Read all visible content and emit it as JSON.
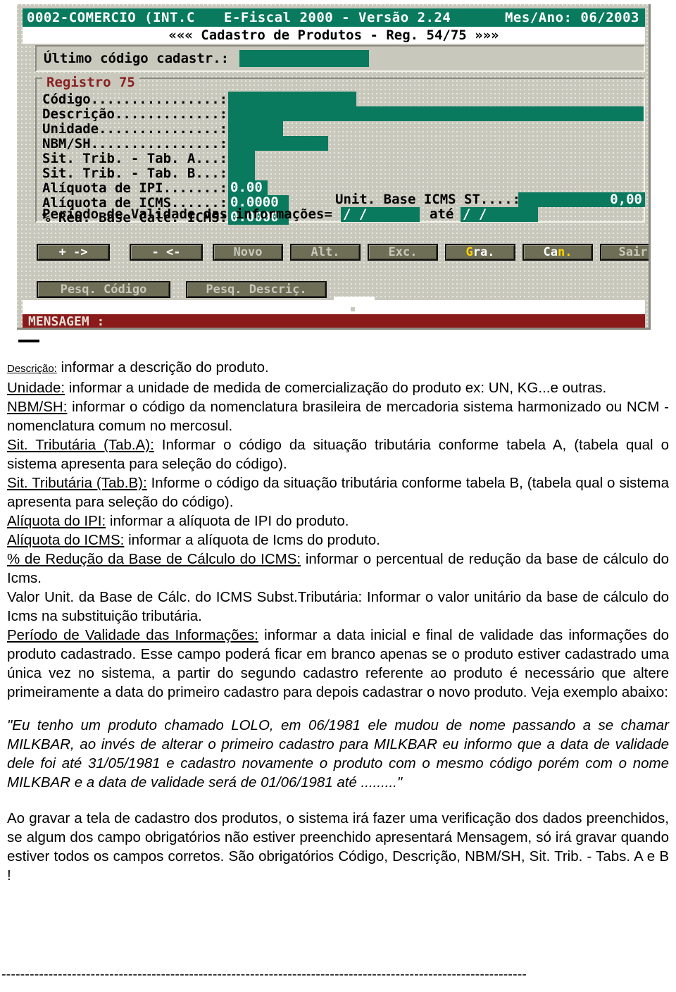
{
  "terminal": {
    "titlebar": {
      "company": "0002-COMERCIO (INT.C",
      "app": "E-Fiscal 2000 - Versão 2.24",
      "period": "Mes/Ano: 06/2003"
    },
    "subtitle": "««« Cadastro de Produtos - Reg. 54/75 »»»",
    "last_code_label": "Último código cadastr.:",
    "last_code_value": "",
    "group_legend": "Registro 75",
    "fields": [
      {
        "label": "Código................:",
        "value": ""
      },
      {
        "label": "Descrição.............:",
        "value": ""
      },
      {
        "label": "Unidade...............:",
        "value": ""
      },
      {
        "label": "NBM/SH................:",
        "value": ""
      },
      {
        "label": "Sit. Trib. - Tab. A...:",
        "value": ""
      },
      {
        "label": "Sit. Trib. - Tab. B...:",
        "value": ""
      },
      {
        "label": "Alíquota de IPI.......:",
        "value": "0.00"
      },
      {
        "label": "Alíquota de ICMS......:",
        "value": "0.0000"
      },
      {
        "label": "% Red. Base Calc. ICMS:",
        "value": "0.0000"
      }
    ],
    "unit_base_icms_st_label": "Unit. Base ICMS ST....:",
    "unit_base_icms_st_value": "0,00",
    "validity_label": "Período de Validade das informações= de",
    "validity_from": "  /  /",
    "validity_until_label": "até",
    "validity_until": "  /  /",
    "buttons_row1": [
      {
        "name": "next",
        "pre": "",
        "hot": "",
        "post": "+ ->"
      },
      {
        "name": "prev",
        "pre": "",
        "hot": "",
        "post": "- <-"
      },
      {
        "name": "novo",
        "pre": "",
        "hot": "",
        "post": "Novo"
      },
      {
        "name": "alt",
        "pre": "",
        "hot": "",
        "post": "Alt."
      },
      {
        "name": "exc",
        "pre": "",
        "hot": "",
        "post": "Exc."
      },
      {
        "name": "gravar",
        "pre": "",
        "hot": "G",
        "post": "ra."
      },
      {
        "name": "cancel",
        "pre": "Ca",
        "hot": "n.",
        "post": ""
      },
      {
        "name": "sair",
        "pre": "",
        "hot": "",
        "post": "Sair"
      }
    ],
    "buttons_row2": [
      {
        "name": "pesq-codigo",
        "label": "Pesq. Código"
      },
      {
        "name": "pesq-descric",
        "label": "Pesq. Descriç."
      }
    ],
    "message_bar_label": "MENSAGEM :",
    "message_bar_text": "",
    "colors": {
      "field_green": "#0a7a5f",
      "panel_gray": "#c8c8bc",
      "message_red": "#8b1a1a",
      "legend_red": "#8b2020",
      "hotkey_yellow": "#ffd400"
    }
  },
  "document": {
    "lines": [
      {
        "id": "descricao",
        "kind": "tiny-lead",
        "label": "Descrição:",
        "text": " informar a descrição do produto."
      },
      {
        "id": "unidade",
        "kind": "underlined-lead",
        "label": "Unidade:",
        "text": " informar a  unidade de medida de comercialização do  produto ex: UN, KG...e outras."
      },
      {
        "id": "nbm-sh",
        "kind": "underlined-lead",
        "label": "NBM/SH:",
        "text": " informar o código da nomenclatura brasileira de mercadoria sistema harmonizado ou NCM - nomenclatura comum no mercosul."
      },
      {
        "id": "sit-trib-a",
        "kind": "underlined-lead",
        "label": "Sit. Tributária (Tab.A):",
        "text": " Informar o  código da situação tributária conforme tabela A, (tabela qual o sistema apresenta para seleção do código)."
      },
      {
        "id": "sit-trib-b",
        "kind": "underlined-lead",
        "label": "Sit. Tributária (Tab.B):",
        "text": " Informe o código da situação tributária conforme tabela B, (tabela qual o sistema apresenta para seleção do código)."
      },
      {
        "id": "aliquota-ipi",
        "kind": "underlined-lead",
        "label": "Alíquota do IPI:",
        "text": " informar a alíquota de IPI do produto."
      },
      {
        "id": "aliquota-icms",
        "kind": "underlined-lead",
        "label": "Alíquota do ICMS:",
        "text": " informar a alíquota de Icms do produto."
      },
      {
        "id": "reducao-base-icms",
        "kind": "underlined-lead",
        "label": "% de Redução da Base de Cálculo do ICMS:",
        "text": " informar o percentual de  redução  da base de cálculo do Icms."
      },
      {
        "id": "valor-unit-base-st",
        "kind": "plain-lead",
        "label": "Valor Unit. da Base de Cálc. do ICMS Subst.Tributária:",
        "text": " Informar o valor unitário da base de cálculo do Icms na substituição tributária."
      },
      {
        "id": "periodo-validade",
        "kind": "underlined-lead",
        "label": "Período de Validade das Informações:",
        "text": " informar a data inicial e final  de  validade  das informações do produto  cadastrado. Esse campo poderá ficar em branco apenas se o produto estiver cadastrado uma única vez no sistema, a partir do segundo  cadastro referente  ao  produto  é  necessário  que  altere  primeiramente  a  data  do primeiro cadastro  para  depois cadastrar o novo  produto. Veja exemplo abaixo:"
      }
    ],
    "example_paragraph": "\"Eu tenho um produto  chamado  LOLO, em  06/1981  ele  mudou  de  nome passando a se chamar MILKBAR, ao invés de alterar o primeiro cadastro para MILKBAR  eu  informo  que a  data  de  validade  dele  foi  até 31/05/1981  e  cadastro  novamente o produto com o mesmo código porém com o nome MILKBAR e a data de validade será de 01/06/1981 até .........\"",
    "closing_paragraph": "Ao gravar a tela de cadastro dos produtos, o sistema irá fazer uma verificação dos dados preenchidos, se algum dos campo obrigatórios não estiver preenchido apresentará Mensagem, só irá gravar quando estiver todos os campos corretos. São obrigatórios Código, Descrição, NBM/SH, Sit. Trib. - Tabs. A e B !",
    "footer_rule": "----------------------------------------------------------------------------------------------------------------"
  }
}
